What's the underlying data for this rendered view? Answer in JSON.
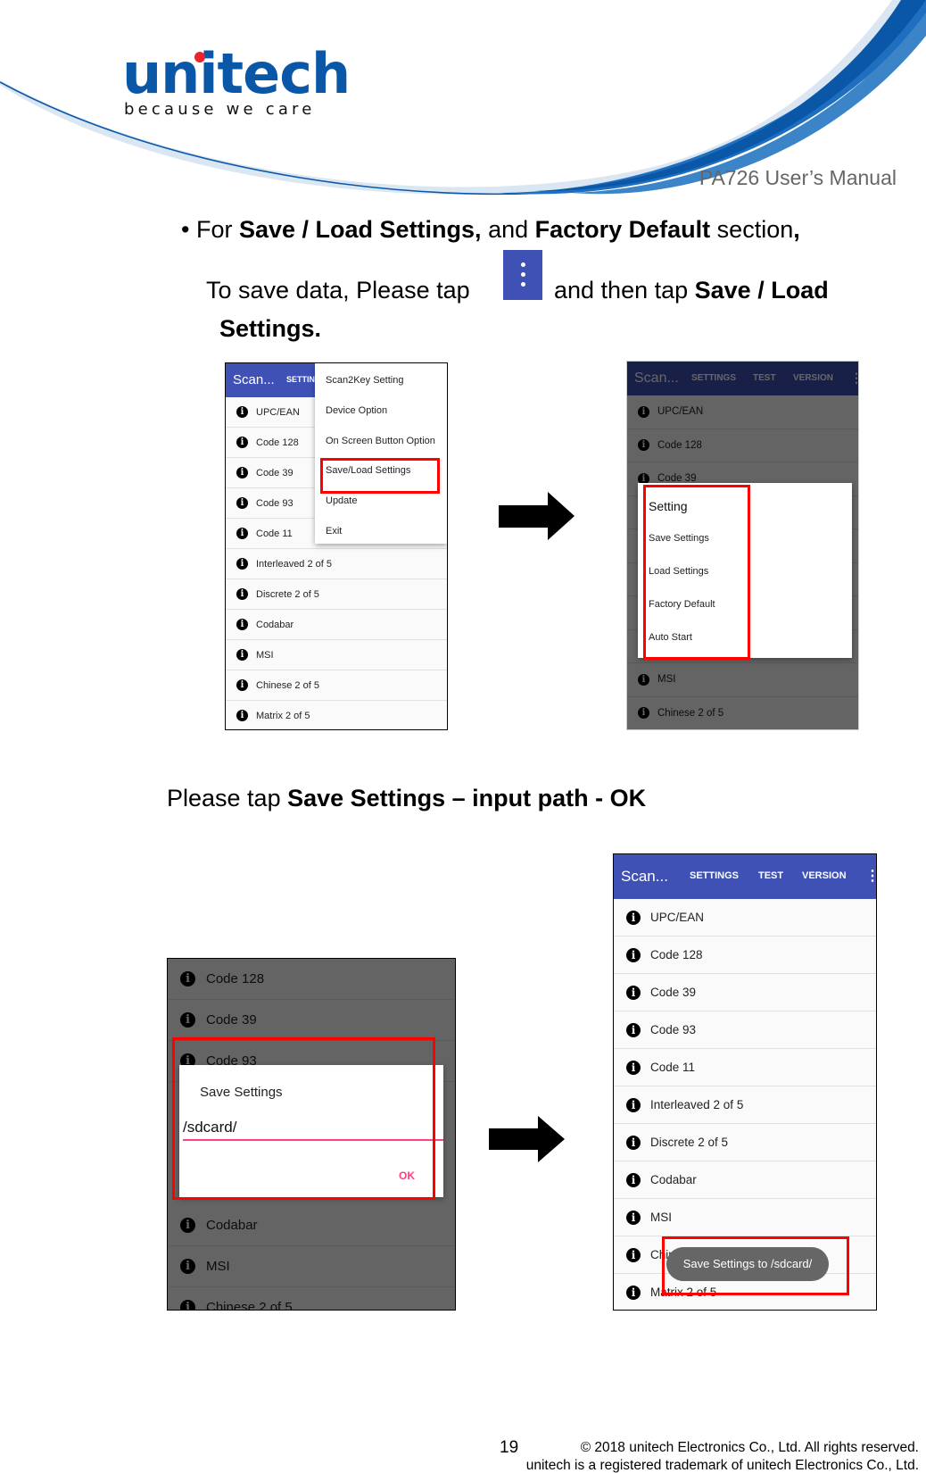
{
  "header": {
    "logo_word": "unitech",
    "logo_tagline": "because we care",
    "manual_title": "PA726 User’s Manual",
    "brand_color": "#0a57a8",
    "accent_dot_color": "#e8262b"
  },
  "instructions": {
    "bullet": "•",
    "line1": {
      "prefix": "For ",
      "bold1": "Save / Load Settings,",
      "mid": " and ",
      "bold2": "Factory Default",
      "suffix": " section",
      "end_bold": ","
    },
    "line2": {
      "prefix": "To save data, Please tap ",
      "icon": "overflow-menu-icon",
      "mid": " and then tap ",
      "bold": "Save / Load"
    },
    "line3_bold": "Settings.",
    "line4": {
      "prefix": "Please tap ",
      "bold": "Save Settings – input path - OK"
    }
  },
  "app": {
    "title": "Scan...",
    "tabs": [
      "SETTINGS",
      "TEST",
      "VERSION"
    ],
    "symbologies": [
      "UPC/EAN",
      "Code 128",
      "Code 39",
      "Code 93",
      "Code 11",
      "Interleaved 2 of 5",
      "Discrete 2 of 5",
      "Codabar",
      "MSI",
      "Chinese 2 of 5",
      "Matrix 2 of 5"
    ],
    "appbar_color": "#3f51b5",
    "highlight_color": "#ff0000"
  },
  "screen1": {
    "title": "Scan...",
    "tab_partial": "SETTIN",
    "overflow_menu": [
      "Scan2Key Setting",
      "Device Option",
      "On Screen Button Option",
      "Save/Load Settings",
      "Update",
      "Exit"
    ],
    "highlighted_item": "Save/Load Settings"
  },
  "screen2": {
    "dialog_title": "Setting",
    "dialog_options": [
      "Save Settings",
      "Load Settings",
      "Factory Default",
      "Auto Start"
    ]
  },
  "screen3": {
    "visible_rows_top": [
      "Code 128",
      "Code 39",
      "Code 93"
    ],
    "visible_rows_bottom": [
      "Codabar",
      "MSI",
      "Chinese 2 of 5"
    ],
    "dialog_title": "Save Settings",
    "path_value": "/sdcard/",
    "ok_label": "OK",
    "accent_color": "#ff4081"
  },
  "screen4": {
    "toast": "Save Settings to /sdcard/"
  },
  "footer": {
    "page_number": "19",
    "copyright": "© 2018 unitech Electronics Co., Ltd. All rights reserved.",
    "trademark": "unitech is a registered trademark of unitech Electronics Co., Ltd."
  }
}
